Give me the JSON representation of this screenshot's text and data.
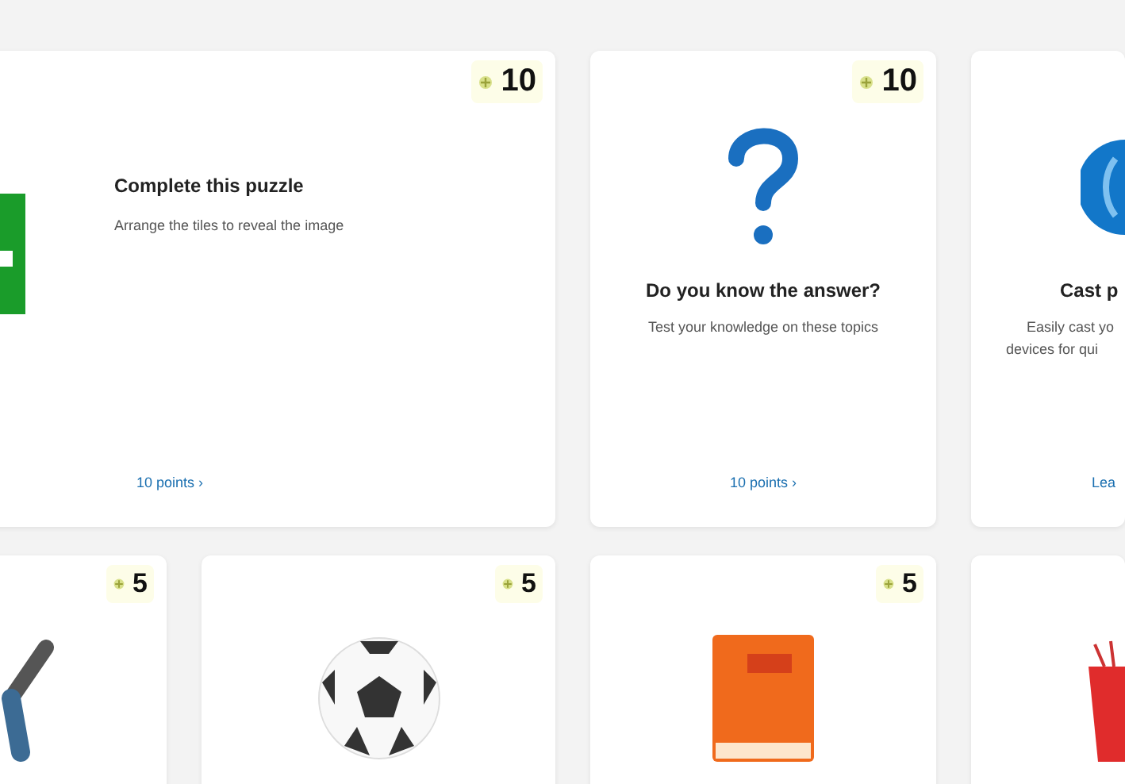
{
  "top_cards": [
    {
      "kind": "wide",
      "points": "10",
      "title": "Complete this puzzle",
      "description": "Arrange the tiles to reveal the image",
      "link": "10 points ›"
    },
    {
      "kind": "tall",
      "points": "10",
      "title": "Do you know the answer?",
      "description": "Test your knowledge on these topics",
      "link": "10 points ›"
    },
    {
      "kind": "edge",
      "title": "Cast p",
      "description_lines": [
        "Easily cast yo",
        "devices for qui"
      ],
      "link": "Lea"
    }
  ],
  "bottom_cards": [
    {
      "points": "5"
    },
    {
      "points": "5"
    },
    {
      "points": "5"
    }
  ]
}
